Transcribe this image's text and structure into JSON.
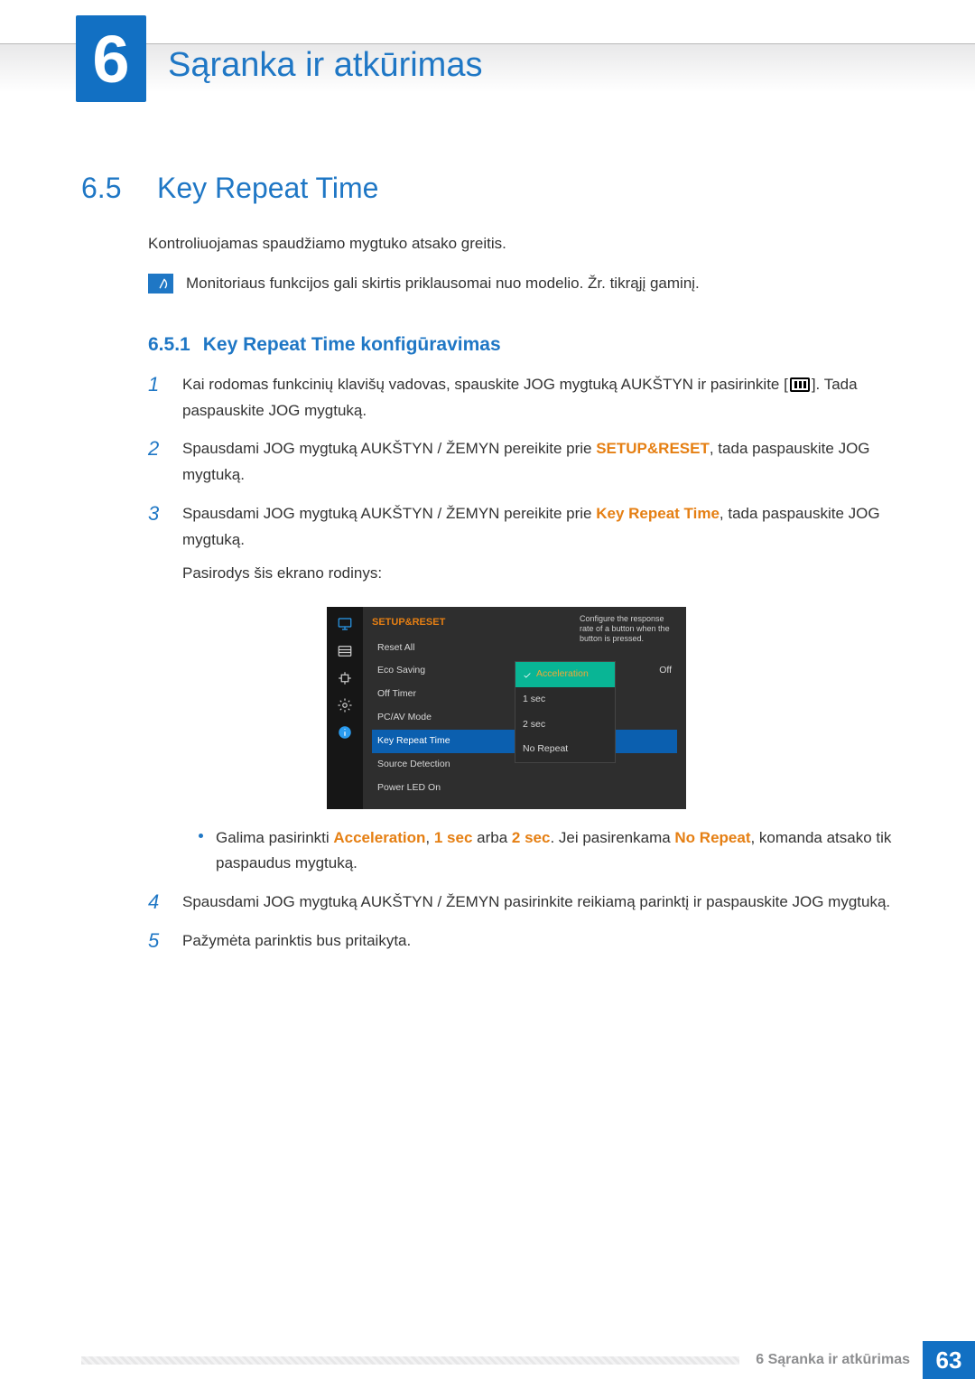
{
  "chapter": {
    "number": "6",
    "title": "Sąranka ir atkūrimas"
  },
  "section": {
    "number": "6.5",
    "title": "Key Repeat Time"
  },
  "intro": "Kontroliuojamas spaudžiamo mygtuko atsako greitis.",
  "note": "Monitoriaus funkcijos gali skirtis priklausomai nuo modelio. Žr. tikrąjį gaminį.",
  "subsection": {
    "number": "6.5.1",
    "title": "Key Repeat Time konfigūravimas"
  },
  "steps": {
    "s1a": "Kai rodomas funkcinių klavišų vadovas, spauskite JOG mygtuką AUKŠTYN ir pasirinkite [",
    "s1b": "]. Tada paspauskite JOG mygtuką.",
    "s2a": "Spausdami JOG mygtuką AUKŠTYN / ŽEMYN pereikite prie ",
    "s2k": "SETUP&RESET",
    "s2b": ", tada paspauskite JOG mygtuką.",
    "s3a": "Spausdami JOG mygtuką AUKŠTYN / ŽEMYN pereikite prie ",
    "s3k": "Key Repeat Time",
    "s3b": ", tada paspauskite JOG mygtuką.",
    "s3c": "Pasirodys šis ekrano rodinys:",
    "bullet_a": "Galima pasirinkti ",
    "bullet_k1": "Acceleration",
    "bullet_sep1": ", ",
    "bullet_k2": "1 sec",
    "bullet_sep2": " arba ",
    "bullet_k3": "2 sec",
    "bullet_sep3": ". Jei pasirenkama ",
    "bullet_k4": "No Repeat",
    "bullet_b": ", komanda atsako tik paspaudus mygtuką.",
    "s4": "Spausdami JOG mygtuką AUKŠTYN / ŽEMYN pasirinkite reikiamą parinktį ir paspauskite JOG mygtuką.",
    "s5": "Pažymėta parinktis bus pritaikyta."
  },
  "step_numbers": {
    "n1": "1",
    "n2": "2",
    "n3": "3",
    "n4": "4",
    "n5": "5"
  },
  "osd": {
    "header": "SETUP&RESET",
    "help": "Configure the response rate of a button when the button is pressed.",
    "items": [
      {
        "label": "Reset All",
        "value": ""
      },
      {
        "label": "Eco Saving",
        "value": "Off"
      },
      {
        "label": "Off Timer",
        "value": ""
      },
      {
        "label": "PC/AV Mode",
        "value": ""
      },
      {
        "label": "Key Repeat Time",
        "value": ""
      },
      {
        "label": "Source Detection",
        "value": ""
      },
      {
        "label": "Power LED On",
        "value": ""
      }
    ],
    "selected_index": 4,
    "popup": [
      "Acceleration",
      "1 sec",
      "2 sec",
      "No Repeat"
    ],
    "popup_selected": 0
  },
  "footer": {
    "label": "6 Sąranka ir atkūrimas",
    "page": "63"
  }
}
